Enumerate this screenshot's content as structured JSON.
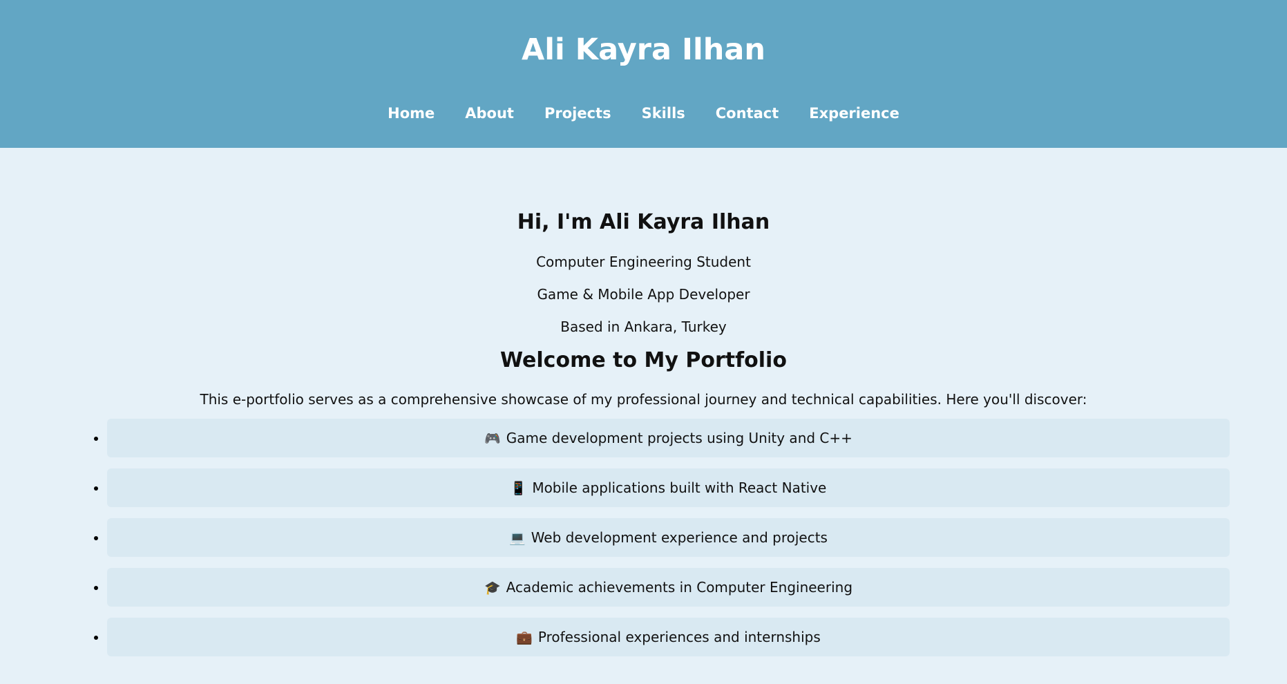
{
  "header": {
    "title": "Ali Kayra Ilhan",
    "nav": [
      {
        "label": "Home"
      },
      {
        "label": "About"
      },
      {
        "label": "Projects"
      },
      {
        "label": "Skills"
      },
      {
        "label": "Contact"
      },
      {
        "label": "Experience"
      }
    ]
  },
  "hero": {
    "greeting": "Hi, I'm Ali Kayra Ilhan",
    "lines": [
      "Computer Engineering Student",
      "Game & Mobile App Developer",
      "Based in Ankara, Turkey"
    ]
  },
  "welcome": {
    "heading": "Welcome to My Portfolio",
    "intro": "This e-portfolio serves as a comprehensive showcase of my professional journey and technical capabilities. Here you'll discover:",
    "items": [
      {
        "emoji": "🎮",
        "icon": "game-controller-icon",
        "text": "Game development projects using Unity and C++"
      },
      {
        "emoji": "📱",
        "icon": "mobile-phone-icon",
        "text": "Mobile applications built with React Native"
      },
      {
        "emoji": "💻",
        "icon": "laptop-icon",
        "text": "Web development experience and projects"
      },
      {
        "emoji": "🎓",
        "icon": "graduation-cap-icon",
        "text": "Academic achievements in Computer Engineering"
      },
      {
        "emoji": "💼",
        "icon": "briefcase-icon",
        "text": "Professional experiences and internships"
      }
    ]
  },
  "colors": {
    "header_bg": "#62a6c4",
    "page_bg": "#e6f1f8",
    "item_bg": "#d9e9f2"
  }
}
